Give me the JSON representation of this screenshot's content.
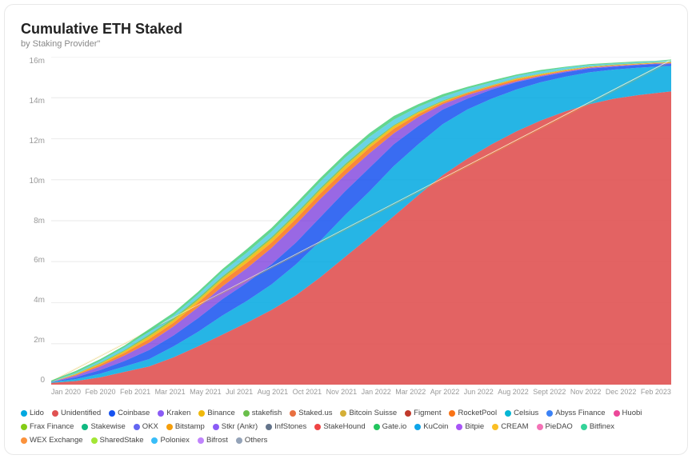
{
  "title": "Cumulative ETH Staked",
  "subtitle": "by Staking Provider\"",
  "yAxis": {
    "labels": [
      "16m",
      "14m",
      "12m",
      "10m",
      "8m",
      "6m",
      "4m",
      "2m",
      "0"
    ]
  },
  "xAxis": {
    "labels": [
      "Jan 2020",
      "Feb 2020",
      "Feb 2021",
      "Mar 2021",
      "May 2021",
      "Jul 2021",
      "Aug 2021",
      "Oct 2021",
      "Nov 2021",
      "Jan 2022",
      "Mar 2022",
      "Apr 2022",
      "Jun 2022",
      "Aug 2022",
      "Sept 2022",
      "Nov 2022",
      "Dec 2022",
      "Feb 2023"
    ]
  },
  "legend": [
    {
      "label": "Lido",
      "color": "#00a8e0"
    },
    {
      "label": "Unidentified",
      "color": "#e05252"
    },
    {
      "label": "Coinbase",
      "color": "#1652f0"
    },
    {
      "label": "Kraken",
      "color": "#8b5cf6"
    },
    {
      "label": "Binance",
      "color": "#f0b90b"
    },
    {
      "label": "stakefish",
      "color": "#6abf4b"
    },
    {
      "label": "Staked.us",
      "color": "#e87040"
    },
    {
      "label": "Bitcoin Suisse",
      "color": "#d4af37"
    },
    {
      "label": "Figment",
      "color": "#c0392b"
    },
    {
      "label": "RocketPool",
      "color": "#f97316"
    },
    {
      "label": "Celsius",
      "color": "#06b6d4"
    },
    {
      "label": "Abyss Finance",
      "color": "#3b82f6"
    },
    {
      "label": "Huobi",
      "color": "#ec4899"
    },
    {
      "label": "Frax Finance",
      "color": "#84cc16"
    },
    {
      "label": "Stakewise",
      "color": "#10b981"
    },
    {
      "label": "OKX",
      "color": "#6366f1"
    },
    {
      "label": "Bitstamp",
      "color": "#f59e0b"
    },
    {
      "label": "Stkr (Ankr)",
      "color": "#8b5cf6"
    },
    {
      "label": "InfStones",
      "color": "#64748b"
    },
    {
      "label": "StakeHound",
      "color": "#ef4444"
    },
    {
      "label": "Gate.io",
      "color": "#22c55e"
    },
    {
      "label": "KuCoin",
      "color": "#0ea5e9"
    },
    {
      "label": "Bitpie",
      "color": "#a855f7"
    },
    {
      "label": "CREAM",
      "color": "#fbbf24"
    },
    {
      "label": "PieDAO",
      "color": "#f472b6"
    },
    {
      "label": "Bitfinex",
      "color": "#34d399"
    },
    {
      "label": "WEX Exchange",
      "color": "#fb923c"
    },
    {
      "label": "SharedStake",
      "color": "#a3e635"
    },
    {
      "label": "Poloniex",
      "color": "#38bdf8"
    },
    {
      "label": "Bifrost",
      "color": "#c084fc"
    },
    {
      "label": "Others",
      "color": "#94a3b8"
    }
  ]
}
